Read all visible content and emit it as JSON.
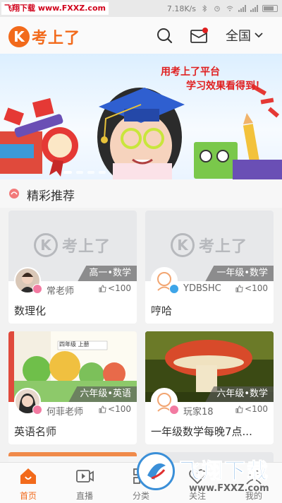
{
  "status_bar": {
    "watermark": "飞翔下载 www.FXXZ.com",
    "speed": "7.18K/s"
  },
  "header": {
    "logo_mark": "K",
    "logo_text": "考上了",
    "region": "全国",
    "icons": [
      "search-icon",
      "mail-icon",
      "chevron-down-icon"
    ],
    "accent_color": "#f26a1b",
    "mail_badge_color": "#e02020"
  },
  "banner": {
    "line1": "用考上了平台",
    "line2": "学习效果看得到！",
    "slides": 4,
    "active_slide": 1
  },
  "section": {
    "title": "精彩推荐"
  },
  "cards": [
    {
      "grade": "高一•数学",
      "teacher": "常老师",
      "likes": "<100",
      "title": "数理化",
      "thumb_logo": "考上了",
      "badge": "pink"
    },
    {
      "grade": "一年级•数学",
      "teacher": "YDBSHC",
      "likes": "<100",
      "title": "哼哈",
      "thumb_logo": "考上了",
      "badge": "blue"
    },
    {
      "grade": "六年级•英语",
      "teacher": "何菲老师",
      "likes": "<100",
      "title": "英语名师",
      "badge": "pink",
      "book_text": "四年级  上册"
    },
    {
      "grade": "六年级•数学",
      "teacher": "玩家18",
      "likes": "<100",
      "title": "一年级数学每晚7点...",
      "badge": "pink"
    }
  ],
  "bottom_nav": [
    {
      "label": "首页",
      "icon": "home-icon",
      "active": true
    },
    {
      "label": "直播",
      "icon": "video-icon",
      "active": false
    },
    {
      "label": "分类",
      "icon": "category-icon",
      "active": false
    },
    {
      "label": "关注",
      "icon": "follow-icon",
      "active": false
    },
    {
      "label": "我的",
      "icon": "profile-icon",
      "active": false
    }
  ],
  "overlay_watermark": {
    "title": "飞翔下载",
    "url": "www.FXXZ.com"
  }
}
